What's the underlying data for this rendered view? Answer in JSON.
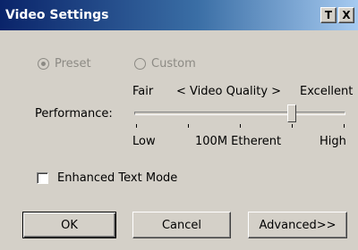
{
  "window": {
    "title": "Video Settings",
    "pin_button_label": "T",
    "close_button_label": "X"
  },
  "mode": {
    "preset_label": "Preset",
    "custom_label": "Custom",
    "selected": "Preset",
    "enabled": false
  },
  "quality": {
    "fair_label": "Fair",
    "axis_label": "< Video Quality >",
    "excellent_label": "Excellent",
    "performance_label": "Performance:",
    "low_label": "Low",
    "mid_label": "100M Etherent",
    "high_label": "High",
    "slider_value_fraction": 0.75,
    "tick_count": 5
  },
  "options": {
    "enhanced_text_label": "Enhanced Text Mode",
    "enhanced_text_checked": false
  },
  "buttons": {
    "ok": "OK",
    "cancel": "Cancel",
    "advanced": "Advanced>>"
  }
}
